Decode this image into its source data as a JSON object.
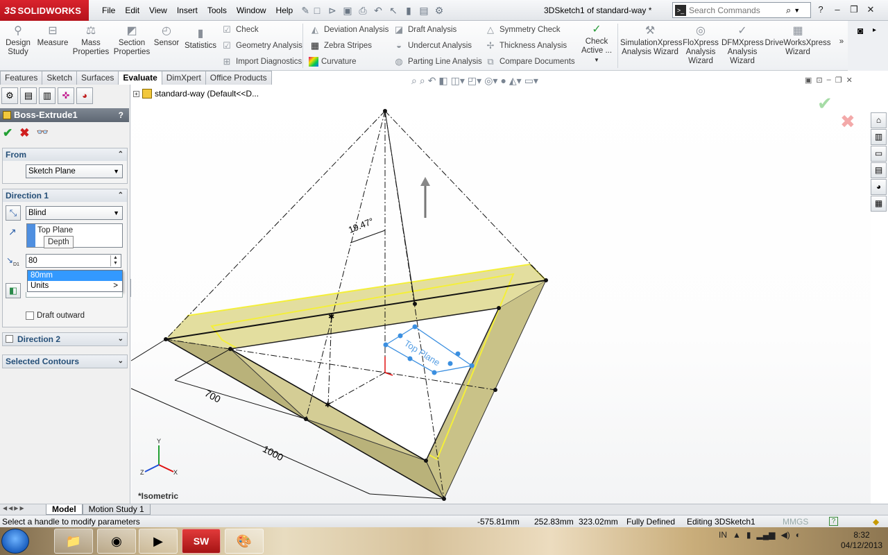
{
  "app": {
    "brand": "SOLIDWORKS",
    "brand_prefix": "3S",
    "doc_title": "3DSketch1 of standard-way *"
  },
  "menu": [
    "File",
    "Edit",
    "View",
    "Insert",
    "Tools",
    "Window",
    "Help"
  ],
  "search": {
    "placeholder": "Search Commands"
  },
  "ribbon": {
    "design_study": "Design Study",
    "measure": "Measure",
    "mass_properties": "Mass Properties",
    "section_properties": "Section Properties",
    "sensor": "Sensor",
    "statistics": "Statistics",
    "check": "Check",
    "geometry_analysis": "Geometry Analysis",
    "import_diagnostics": "Import Diagnostics",
    "deviation_analysis": "Deviation Analysis",
    "zebra_stripes": "Zebra Stripes",
    "curvature": "Curvature",
    "draft_analysis": "Draft Analysis",
    "undercut_analysis": "Undercut Analysis",
    "parting_line_analysis": "Parting Line Analysis",
    "symmetry_check": "Symmetry Check",
    "thickness_analysis": "Thickness Analysis",
    "compare_documents": "Compare Documents",
    "check_active": "Check Active ...",
    "simulationxpress": "SimulationXpress Analysis Wizard",
    "floxpress": "FloXpress Analysis Wizard",
    "dfmxpress": "DFMXpress Analysis Wizard",
    "driveworksxpress": "DriveWorksXpress Wizard"
  },
  "tabs": [
    "Features",
    "Sketch",
    "Surfaces",
    "Evaluate",
    "DimXpert",
    "Office Products"
  ],
  "active_tab": "Evaluate",
  "property_manager": {
    "title": "Boss-Extrude1",
    "help": "?",
    "from": {
      "label": "From",
      "value": "Sketch Plane"
    },
    "direction1": {
      "label": "Direction 1",
      "end_condition": "Blind",
      "selection": "Top Plane",
      "tooltip": "Depth",
      "depth_value": "80",
      "depth_symbol": "D1",
      "dropdown_options": [
        "80mm",
        "Units"
      ],
      "dropdown_more": ">",
      "draft_outward": "Draft outward"
    },
    "direction2": {
      "label": "Direction 2"
    },
    "selected_contours": {
      "label": "Selected Contours"
    }
  },
  "tree_root": "standard-way  (Default<<D...",
  "view": {
    "orientation": "*Isometric",
    "angle_dim": "19.47°",
    "dim_700": "700",
    "dim_1000": "1000",
    "plane_label": "Top Plane",
    "axis_x": "X",
    "axis_y": "Y",
    "axis_z": "Z"
  },
  "bottom_tabs": [
    "Model",
    "Motion Study 1"
  ],
  "status": {
    "message": "Select a handle to modify parameters",
    "x": "-575.81mm",
    "y": "252.83mm",
    "z": "323.02mm",
    "state": "Fully Defined",
    "editing": "Editing 3DSketch1",
    "units": "MMGS"
  },
  "taskbar": {
    "lang": "IN",
    "time": "8:32",
    "date": "04/12/2013"
  },
  "colors": {
    "brand": "#c8102e",
    "extrude_face": "#d9d39a",
    "highlight": "#f4ef3a",
    "plane": "#3b8fe0"
  }
}
